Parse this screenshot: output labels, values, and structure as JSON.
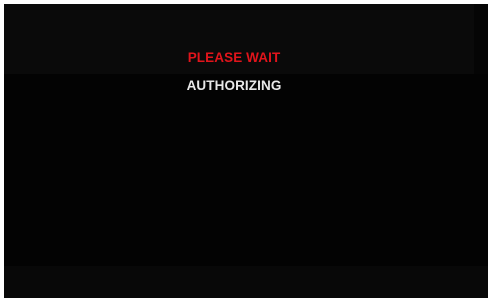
{
  "screen": {
    "title": "PLEASE WAIT",
    "status": "AUTHORIZING",
    "colors": {
      "background": "#050505",
      "title": "#e1141b",
      "status": "#e8e8e8"
    }
  }
}
